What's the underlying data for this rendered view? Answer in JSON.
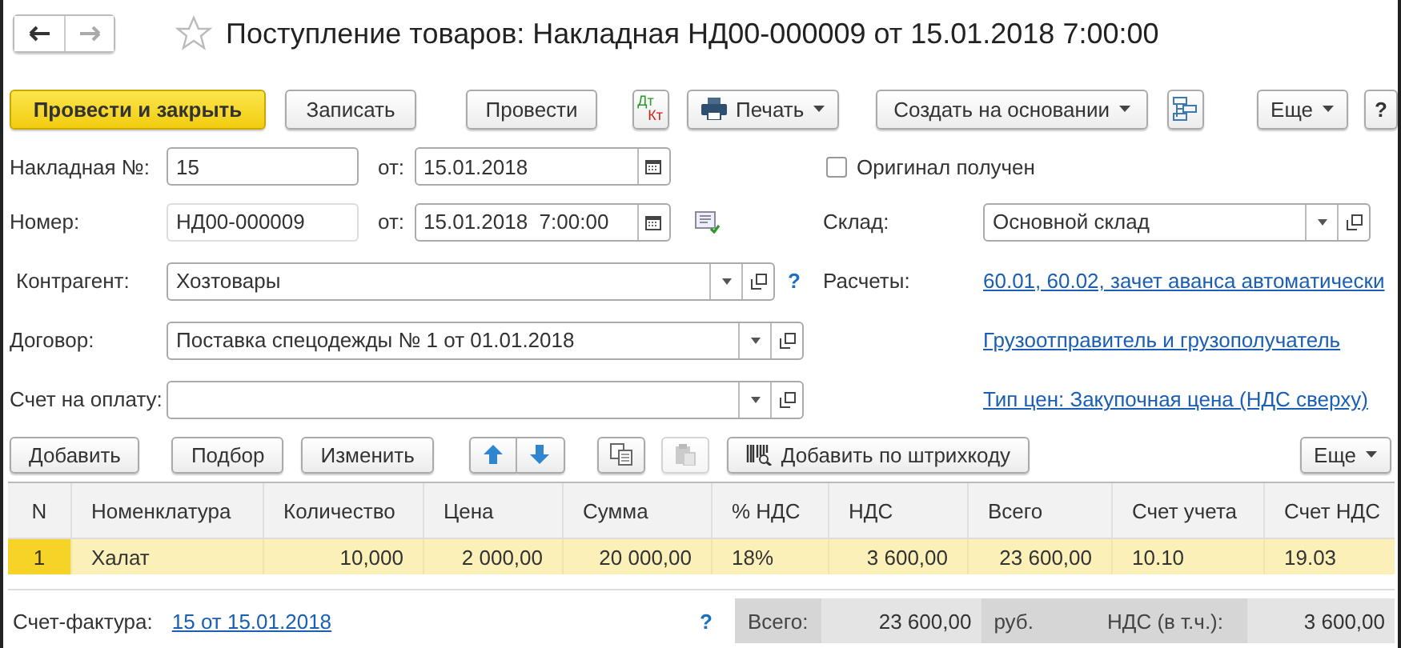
{
  "window": {
    "title": "Поступление товаров: Накладная НД00-000009 от 15.01.2018 7:00:00",
    "favorite": false
  },
  "toolbar": [
    {
      "kind": "primary",
      "label": "Провести и закрыть"
    },
    {
      "kind": "plain",
      "label": "Записать"
    },
    {
      "kind": "plain",
      "label": "Провести"
    },
    {
      "kind": "dtkt",
      "label": "Дт",
      "label2": "Кт"
    },
    {
      "kind": "print",
      "label": "Печать"
    },
    {
      "kind": "menu",
      "label": "Создать на основании"
    },
    {
      "kind": "structure"
    },
    {
      "kind": "menu",
      "label": "Еще"
    },
    {
      "kind": "plain",
      "label": "?"
    }
  ],
  "form": {
    "invoice_no": {
      "label": "Накладная №:",
      "value": "15",
      "date_label": "от:",
      "date": "15.01.2018"
    },
    "number": {
      "label": "Номер:",
      "value": "НД00-000009",
      "date_label": "от:",
      "date": "15.01.2018  7:00:00"
    },
    "counterparty": {
      "label": "Контрагент:",
      "value": "Хозтовары",
      "help": "?"
    },
    "contract": {
      "label": "Договор:",
      "value": "Поставка спецодежды № 1 от 01.01.2018"
    },
    "payment_invoice": {
      "label": "Счет на оплату:"
    },
    "original_received": {
      "label": "Оригинал получен",
      "checked": false
    },
    "warehouse": {
      "label": "Склад:",
      "value": "Основной склад"
    },
    "settlements": {
      "label": "Расчеты:",
      "link": "60.01, 60.02, зачет аванса автоматически"
    },
    "links": [
      "Грузоотправитель и грузополучатель",
      "Тип цен: Закупочная цена (НДС сверху)"
    ]
  },
  "table_toolbar": [
    {
      "kind": "plain",
      "label": "Добавить"
    },
    {
      "kind": "plain",
      "label": "Подбор"
    },
    {
      "kind": "plain",
      "label": "Изменить"
    },
    {
      "kind": "up"
    },
    {
      "kind": "down"
    },
    {
      "kind": "copy",
      "disabled": false
    },
    {
      "kind": "paste",
      "disabled": true
    },
    {
      "kind": "barcode",
      "label": "Добавить по штрихкоду"
    },
    {
      "kind": "menu",
      "label": "Еще"
    }
  ],
  "table": {
    "columns": [
      "N",
      "Номенклатура",
      "Количество",
      "Цена",
      "Сумма",
      "% НДС",
      "НДС",
      "Всего",
      "Счет учета",
      "Счет НДС"
    ],
    "rows": [
      {
        "selected": true,
        "cells": [
          "1",
          "Халат",
          "10,000",
          "2 000,00",
          "20 000,00",
          "18%",
          "3 600,00",
          "23 600,00",
          "10.10",
          "19.03"
        ]
      }
    ]
  },
  "footer": {
    "invoice_label": "Счет-фактура:",
    "invoice_link": "15 от 15.01.2018",
    "help": "?",
    "total_label": "Всего:",
    "total": "23 600,00",
    "currency": "руб.",
    "vat_label": "НДС (в т.ч.):",
    "vat": "3 600,00"
  }
}
